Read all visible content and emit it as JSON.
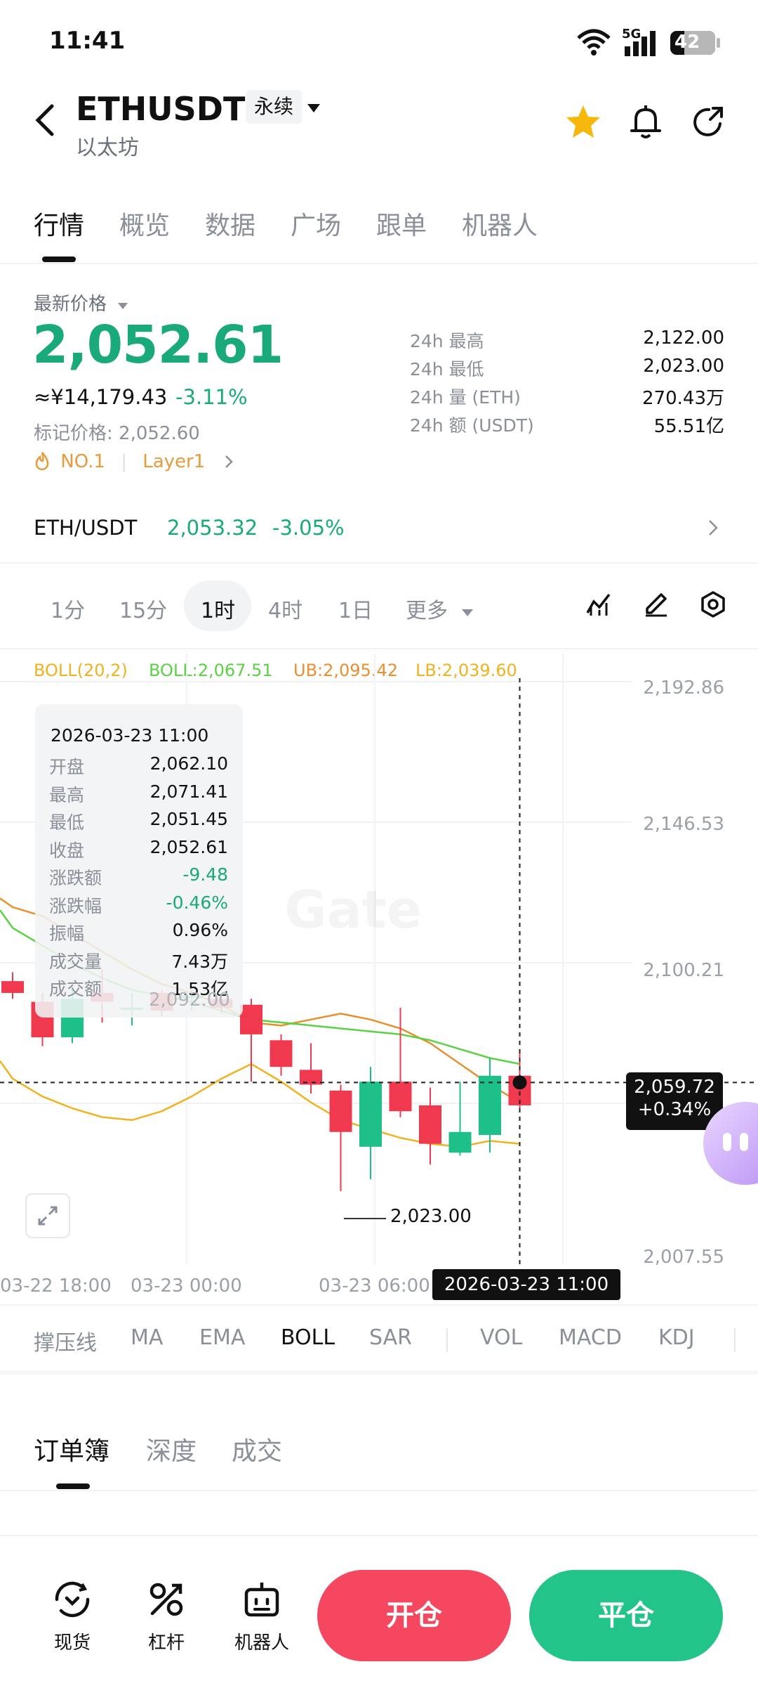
{
  "status_bar": {
    "time": "11:41",
    "network": "5G",
    "battery": "42"
  },
  "header": {
    "symbol": "ETHUSDT",
    "contract_type": "永续",
    "subtitle": "以太坊"
  },
  "tabs": [
    "行情",
    "概览",
    "数据",
    "广场",
    "跟单",
    "机器人"
  ],
  "price_section": {
    "label": "最新价格",
    "last_price": "2,052.61",
    "cny_price": "≈¥14,179.43",
    "change_pct": "-3.11%",
    "mark_price": "标记价格: 2,052.60",
    "tag_rank": "NO.1",
    "tag_sector": "Layer1"
  },
  "stats": [
    {
      "label": "24h  最高",
      "value": "2,122.00"
    },
    {
      "label": "24h  最低",
      "value": "2,023.00"
    },
    {
      "label": "24h  量 (ETH)",
      "value": "270.43万"
    },
    {
      "label": "24h  额 (USDT)",
      "value": "55.51亿"
    }
  ],
  "spot_row": {
    "pair": "ETH/USDT",
    "price": "2,053.32",
    "change": "-3.05%"
  },
  "timeframes": [
    "1分",
    "15分",
    "1时",
    "4时",
    "1日",
    "更多"
  ],
  "boll": {
    "name": "BOLL(20,2)",
    "mid": "BOLL:2,067.51",
    "ub": "UB:2,095.42",
    "lb": "LB:2,039.60"
  },
  "tooltip": {
    "datetime": "2026-03-23 11:00",
    "rows": [
      {
        "label": "开盘",
        "value": "2,062.10"
      },
      {
        "label": "最高",
        "value": "2,071.41"
      },
      {
        "label": "最低",
        "value": "2,051.45"
      },
      {
        "label": "收盘",
        "value": "2,052.61"
      },
      {
        "label": "涨跌额",
        "value": "-9.48"
      },
      {
        "label": "涨跌幅",
        "value": "-0.46%"
      },
      {
        "label": "振幅",
        "value": "0.96%"
      },
      {
        "label": "成交量",
        "value": "7.43万"
      },
      {
        "label": "成交额",
        "value": "1.53亿"
      }
    ]
  },
  "chart": {
    "y_axis": [
      "2,192.86",
      "2,146.53",
      "2,100.21",
      "2,007.55"
    ],
    "ghost_label": "2,092.00",
    "low_marker": "2,023.00",
    "cursor_price": "2,059.72",
    "cursor_change": "+0.34%",
    "x_axis": [
      "03-22 18:00",
      "03-23 00:00",
      "03-23 06:00"
    ],
    "cursor_time": "2026-03-23 11:00",
    "watermark": "Gate"
  },
  "chart_data": {
    "type": "candlestick",
    "y_range": [
      2007.55,
      2192.86
    ],
    "candles": [
      {
        "o": 2094,
        "c": 2090,
        "h": 2097,
        "l": 2088
      },
      {
        "o": 2087,
        "c": 2075,
        "h": 2090,
        "l": 2072
      },
      {
        "o": 2075,
        "c": 2088,
        "h": 2092,
        "l": 2073
      },
      {
        "o": 2090,
        "c": 2087,
        "h": 2098,
        "l": 2080
      },
      {
        "o": 2085,
        "c": 2085,
        "h": 2090,
        "l": 2079
      },
      {
        "o": 2090,
        "c": 2084,
        "h": 2091,
        "l": 2082
      },
      {
        "o": 2089,
        "c": 2089,
        "h": 2093,
        "l": 2084
      },
      {
        "o": 2088,
        "c": 2085,
        "h": 2090,
        "l": 2083
      },
      {
        "o": 2086,
        "c": 2076,
        "h": 2088,
        "l": 2060
      },
      {
        "o": 2074,
        "c": 2065,
        "h": 2076,
        "l": 2062
      },
      {
        "o": 2064,
        "c": 2059,
        "h": 2073,
        "l": 2056
      },
      {
        "o": 2057,
        "c": 2043,
        "h": 2059,
        "l": 2023
      },
      {
        "o": 2038,
        "c": 2060,
        "h": 2065,
        "l": 2027
      },
      {
        "o": 2060,
        "c": 2050,
        "h": 2085,
        "l": 2048
      },
      {
        "o": 2052,
        "c": 2039,
        "h": 2058,
        "l": 2032
      },
      {
        "o": 2036,
        "c": 2043,
        "h": 2060,
        "l": 2035
      },
      {
        "o": 2042,
        "c": 2062,
        "h": 2068,
        "l": 2036
      },
      {
        "o": 2062,
        "c": 2052,
        "h": 2071,
        "l": 2051
      }
    ],
    "ub": [
      2119,
      2116,
      2110,
      2104,
      2098,
      2093,
      2090,
      2086,
      2080,
      2079,
      2081,
      2083,
      2081,
      2078,
      2073,
      2066,
      2059,
      2053
    ],
    "mid": [
      2112,
      2106,
      2100,
      2095,
      2091,
      2089,
      2087,
      2084,
      2081,
      2080,
      2079,
      2078,
      2077,
      2076,
      2074,
      2071,
      2068,
      2066
    ],
    "lb": [
      2061,
      2055,
      2051,
      2048,
      2047,
      2050,
      2055,
      2061,
      2066,
      2060,
      2053,
      2047,
      2044,
      2041,
      2039,
      2038,
      2040,
      2039
    ]
  },
  "indicators": [
    "撑压线",
    "MA",
    "EMA",
    "BOLL",
    "SAR",
    "VOL",
    "MACD",
    "KDJ"
  ],
  "book_tabs": [
    "订单簿",
    "深度",
    "成交"
  ],
  "bottom_nav": {
    "spot": "现货",
    "leverage": "杠杆",
    "bot": "机器人",
    "open": "开仓",
    "close": "平仓"
  },
  "colors": {
    "up": "#1dc089",
    "down": "#f0384f",
    "accent": "#1aa97b",
    "boll_mid": "#5bd245",
    "boll_ub": "#e8902f",
    "boll_lb": "#f0b21e"
  }
}
